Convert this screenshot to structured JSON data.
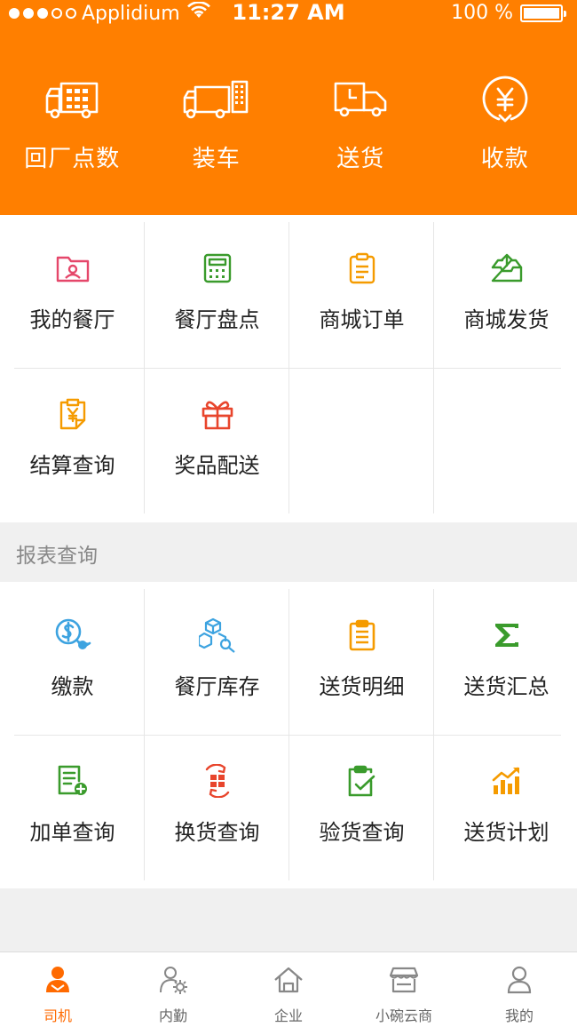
{
  "status_bar": {
    "carrier": "Applidium",
    "time": "11:27 AM",
    "battery_text": "100 %",
    "battery_level": 1.0
  },
  "colors": {
    "brand_orange": "#ff7f00",
    "green": "#3a9b2c",
    "orange_icon": "#f59b00",
    "red": "#e8452c",
    "pink": "#e5476a",
    "blue": "#3da3e0"
  },
  "top_actions": [
    {
      "label": "回厂点数",
      "icon": "truck-crates-icon"
    },
    {
      "label": "装车",
      "icon": "loading-truck-icon"
    },
    {
      "label": "送货",
      "icon": "delivery-truck-clock-icon"
    },
    {
      "label": "收款",
      "icon": "yuan-collect-icon"
    }
  ],
  "main_menu": [
    {
      "label": "我的餐厅",
      "icon": "folder-user-icon"
    },
    {
      "label": "餐厅盘点",
      "icon": "calculator-icon"
    },
    {
      "label": "商城订单",
      "icon": "clipboard-list-icon"
    },
    {
      "label": "商城发货",
      "icon": "inbox-upload-icon"
    },
    {
      "label": "结算查询",
      "icon": "yuan-document-icon"
    },
    {
      "label": "奖品配送",
      "icon": "gift-icon"
    }
  ],
  "report_section": {
    "title": "报表查询",
    "items": [
      {
        "label": "缴款",
        "icon": "dollar-touch-icon"
      },
      {
        "label": "餐厅库存",
        "icon": "boxes-search-icon"
      },
      {
        "label": "送货明细",
        "icon": "clipboard-detail-icon"
      },
      {
        "label": "送货汇总",
        "icon": "sigma-icon"
      },
      {
        "label": "加单查询",
        "icon": "document-plus-icon"
      },
      {
        "label": "换货查询",
        "icon": "exchange-box-icon"
      },
      {
        "label": "验货查询",
        "icon": "clipboard-check-icon"
      },
      {
        "label": "送货计划",
        "icon": "bar-chart-trend-icon"
      }
    ]
  },
  "tab_bar": {
    "items": [
      {
        "label": "司机",
        "icon": "driver-icon",
        "active": true
      },
      {
        "label": "内勤",
        "icon": "staff-gear-icon",
        "active": false
      },
      {
        "label": "企业",
        "icon": "home-icon",
        "active": false
      },
      {
        "label": "小碗云商",
        "icon": "shop-icon",
        "active": false
      },
      {
        "label": "我的",
        "icon": "person-icon",
        "active": false
      }
    ]
  }
}
